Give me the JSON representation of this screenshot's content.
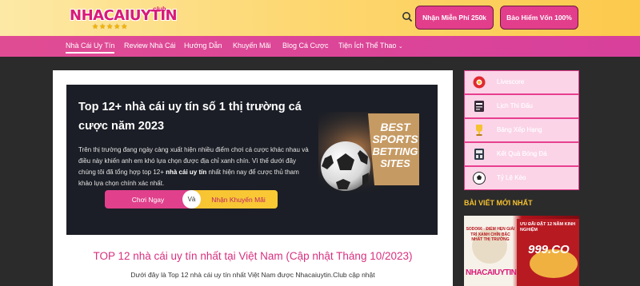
{
  "header": {
    "logo_text": "NHACAIUYTIN",
    "logo_suffix": "club",
    "logo_stars": "★★★★★",
    "buttons": [
      "Nhận Miễn Phí 250k",
      "Bảo Hiểm Vốn 100%"
    ]
  },
  "nav": {
    "items": [
      "Nhà Cái Uy Tín",
      "Review Nhà Cái",
      "Hướng Dẫn",
      "Khuyến Mãi",
      "Blog Cá Cược",
      "Tiện Ích Thể Thao"
    ],
    "active_index": 0
  },
  "hero": {
    "title": "Top 12+ nhà cái uy tín số 1 thị trường cá cược năm 2023",
    "desc_start": "Trên thị trường đang ngày càng xuất hiện nhiều điểm chơi cá cược khác nhau và điều này khiến anh em khó lựa chọn được địa chỉ xanh chín. Vì thế dưới đây chúng tôi đã tổng hợp top 12+ ",
    "desc_bold": "nhà cái uy tín",
    "desc_end": " nhất hiện nay để cược thủ tham khảo lựa chọn chính xác nhất.",
    "cta_left": "Chơi Ngay",
    "cta_vs": "Và",
    "cta_right": "Nhận Khuyến Mãi",
    "badge_lines": [
      "BEST",
      "SPORTS",
      "BETTING",
      "SITES"
    ]
  },
  "content": {
    "heading": "TOP 12 nhà cái uy tín nhất tại Việt Nam (Cập nhật Tháng 10/2023)",
    "intro": "Dưới đây là Top 12 nhà cái uy tín nhất Việt Nam được Nhacaiuytin.Club cập nhật"
  },
  "sidebar": {
    "items": [
      {
        "label": "Livescore",
        "icon": "livescore-icon"
      },
      {
        "label": "Lịch Thi Đấu",
        "icon": "calendar-icon"
      },
      {
        "label": "Bảng Xếp Hạng",
        "icon": "trophy-icon"
      },
      {
        "label": "Kết Quả Bóng Đá",
        "icon": "scoreboard-icon"
      },
      {
        "label": "Tỷ Lệ Kèo",
        "icon": "soccer-ball-icon"
      }
    ],
    "latest_heading": "BÀI VIẾT MỚI NHẤT",
    "ad": {
      "logo": "NHACAIUYTIN",
      "promo": "ƯU ĐÃI ĐẶT 12 NĂM KINH NGHIỆM",
      "brand": "999.CO",
      "side_text": "SODO66 - ĐIỂM HẸN GIẢI TRÍ XANH CHÍN BẬC NHẤT THỊ TRƯỜNG"
    }
  },
  "colors": {
    "brand_pink": "#e23e8c",
    "accent_yellow": "#f5c230",
    "hero_bg": "#1b1e26"
  }
}
